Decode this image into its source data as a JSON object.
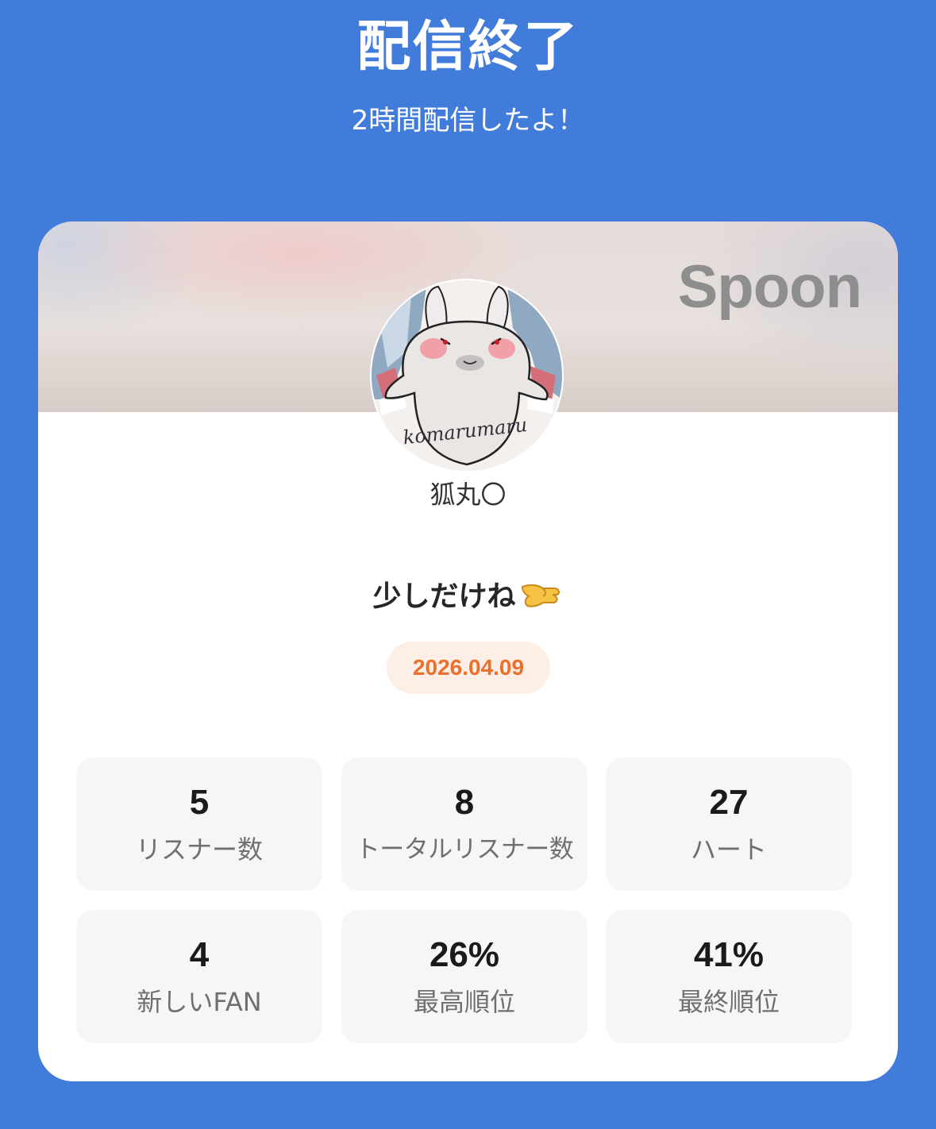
{
  "header": {
    "title": "配信終了",
    "subtitle": "2時間配信したよ！"
  },
  "card": {
    "logo": "Spoon",
    "avatar": {
      "signature": "komarumaru"
    },
    "username": "狐丸〇",
    "broadcast_title": "少しだけね",
    "title_icon": "pinching-hand-icon",
    "date": "2026.04.09",
    "stats": [
      {
        "value": "5",
        "label": "リスナー数"
      },
      {
        "value": "8",
        "label": "トータルリスナー数"
      },
      {
        "value": "27",
        "label": "ハート"
      },
      {
        "value": "4",
        "label": "新しいFAN"
      },
      {
        "value": "26%",
        "label": "最高順位"
      },
      {
        "value": "41%",
        "label": "最終順位"
      }
    ]
  },
  "colors": {
    "background": "#417cdb",
    "card": "#ffffff",
    "date_text": "#ec6f2c",
    "date_badge": "#fdeee6",
    "stat_tile": "#f6f6f6",
    "logo": "#8e8e8e"
  }
}
